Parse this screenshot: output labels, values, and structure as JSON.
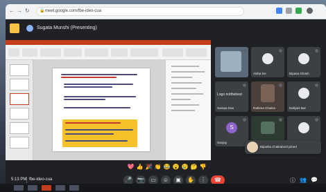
{
  "browser": {
    "url": "meet.google.com/fbe-ideo-cua",
    "back_icon": "arrow-left-icon",
    "forward_icon": "arrow-right-icon",
    "reload_icon": "reload-icon",
    "lock_icon": "lock-icon"
  },
  "meeting": {
    "presenter_label": "Sugata Munshi (Presenting)",
    "time": "5:13 PM",
    "code": "fbe-ideo-cua"
  },
  "participants": [
    {
      "name": "",
      "initial": "",
      "avatar_color": "#3c4043"
    },
    {
      "name": "Aisha De",
      "initial": "",
      "avatar_color": "#e8eaed"
    },
    {
      "name": "Bipasa Ghosh",
      "initial": "",
      "avatar_color": "#e8eaed"
    },
    {
      "name": "Logo notthebest",
      "initial": "",
      "avatar_color": "#3c4043"
    },
    {
      "name": "Rahima Chakra",
      "initial": "",
      "avatar_color": "#3c4043"
    },
    {
      "name": "Debjani Bar",
      "initial": "",
      "avatar_color": "#e8eaed"
    },
    {
      "name": "Sampa Das",
      "initial": "",
      "avatar_color": "#3c4043"
    },
    {
      "name": "Sanjay",
      "initial": "S",
      "avatar_color": "#8e63ce"
    }
  ],
  "notification": {
    "text": "Bipasha Chakraborti joined"
  },
  "reactions": [
    "💖",
    "👍",
    "🎉",
    "👏",
    "😂",
    "😮",
    "😢",
    "🤔",
    "👎"
  ],
  "controls": {
    "mic_icon": "microphone-icon",
    "camera_icon": "camera-icon",
    "captions_icon": "captions-icon",
    "emoji_icon": "emoji-icon",
    "present_icon": "present-icon",
    "raise_hand_icon": "raise-hand-icon",
    "more_icon": "more-options-icon",
    "end_call_icon": "end-call-icon",
    "info_icon": "info-icon",
    "people_icon": "people-icon",
    "chat_icon": "chat-icon"
  },
  "colors": {
    "meet_bg": "#202124",
    "tile_bg": "#3c4043",
    "end_call": "#ea4335",
    "ppt_accent": "#c43e1c",
    "slide_highlight": "#f6c12b"
  }
}
